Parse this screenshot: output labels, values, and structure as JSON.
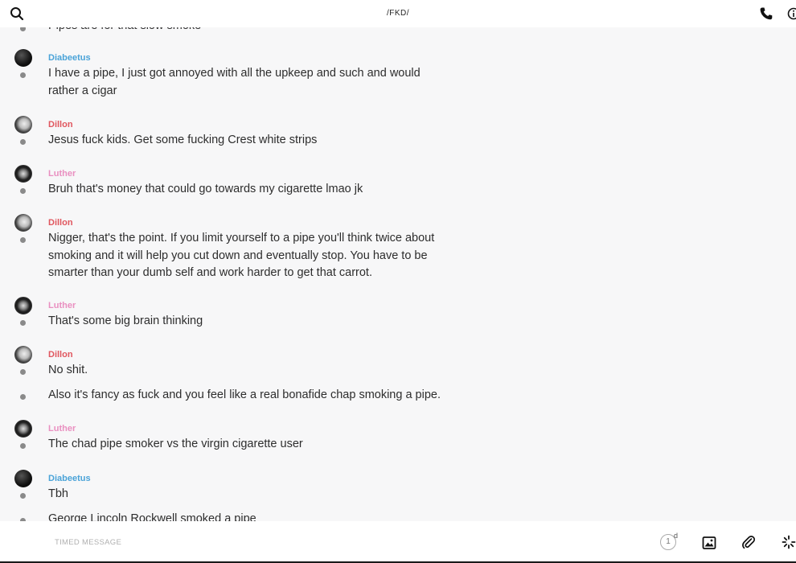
{
  "header": {
    "title": "/FKD/",
    "icons": {
      "search": "search-icon",
      "call": "phone-icon",
      "info": "info-icon"
    }
  },
  "messages": [
    {
      "text": "Pipes are for that slow smoke"
    },
    {
      "sender": "Diabeetus",
      "text": "I have a pipe, I just got annoyed with all the upkeep and such and would rather a cigar"
    },
    {
      "sender": "Dillon",
      "text": "Jesus fuck kids. Get some fucking Crest white strips"
    },
    {
      "sender": "Luther",
      "text": "Bruh that's money that could go towards my cigarette lmao jk"
    },
    {
      "sender": "Dillon",
      "text": "Nigger, that's the point. If you limit yourself to a pipe you'll think twice about smoking and it will help you cut down and eventually stop. You have to be smarter than your dumb self and work harder to get that carrot."
    },
    {
      "sender": "Luther",
      "text": "That's some big brain thinking"
    },
    {
      "sender": "Dillon",
      "text": "No shit."
    },
    {
      "text": "Also it's fancy as fuck and you feel like a real bonafide chap smoking a pipe."
    },
    {
      "sender": "Luther",
      "text": "The chad pipe smoker vs the virgin cigarette user"
    },
    {
      "sender": "Diabeetus",
      "text": "Tbh"
    },
    {
      "text": "George Lincoln Rockwell smoked a pipe"
    }
  ],
  "composer": {
    "placeholder": "TIMED MESSAGE",
    "timer_value": "1",
    "timer_unit": "d"
  },
  "colors": {
    "diabeetus": "#4aa3d8",
    "dillon": "#e0565e",
    "luther": "#e98fc0"
  }
}
